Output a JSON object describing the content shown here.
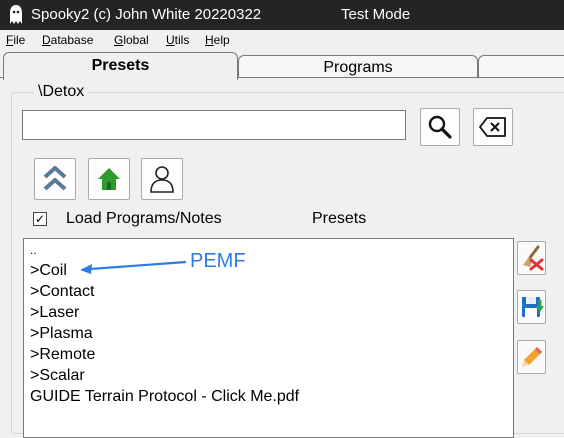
{
  "window": {
    "title": "Spooky2 (c) John White 20220322",
    "mode": "Test Mode"
  },
  "menu": [
    "File",
    "Database",
    "Global",
    "Utils",
    "Help"
  ],
  "tabs": [
    {
      "label": "Presets",
      "active": true
    },
    {
      "label": "Programs",
      "active": false
    }
  ],
  "path": {
    "label": "\\Detox"
  },
  "search": {
    "value": "",
    "placeholder": ""
  },
  "icons": {
    "search": "magnifier-icon",
    "clear": "backspace-clear-icon",
    "up": "double-chevron-up-icon",
    "home": "home-icon",
    "user": "user-icon",
    "delete": "broom-delete-icon",
    "save": "floppy-save-icon",
    "edit": "pencil-edit-icon"
  },
  "options": {
    "load_programs_notes": {
      "label": "Load Programs/Notes",
      "checked": true
    },
    "list_title": "Presets"
  },
  "list": {
    "items": [
      "..",
      ">Coil",
      ">Contact",
      ">Laser",
      ">Plasma",
      ">Remote",
      ">Scalar",
      "GUIDE Terrain Protocol - Click Me.pdf"
    ]
  },
  "annotation": {
    "text": "PEMF",
    "color": "#2b7ce6"
  },
  "colors": {
    "titlebar": "#242424",
    "home_green": "#2e9b2e",
    "up_arrow": "#5a7a9a",
    "save_blue": "#1f6fc8",
    "save_green": "#2ea44f",
    "delete_red": "#d9343a",
    "pencil_orange": "#f2a12a"
  }
}
